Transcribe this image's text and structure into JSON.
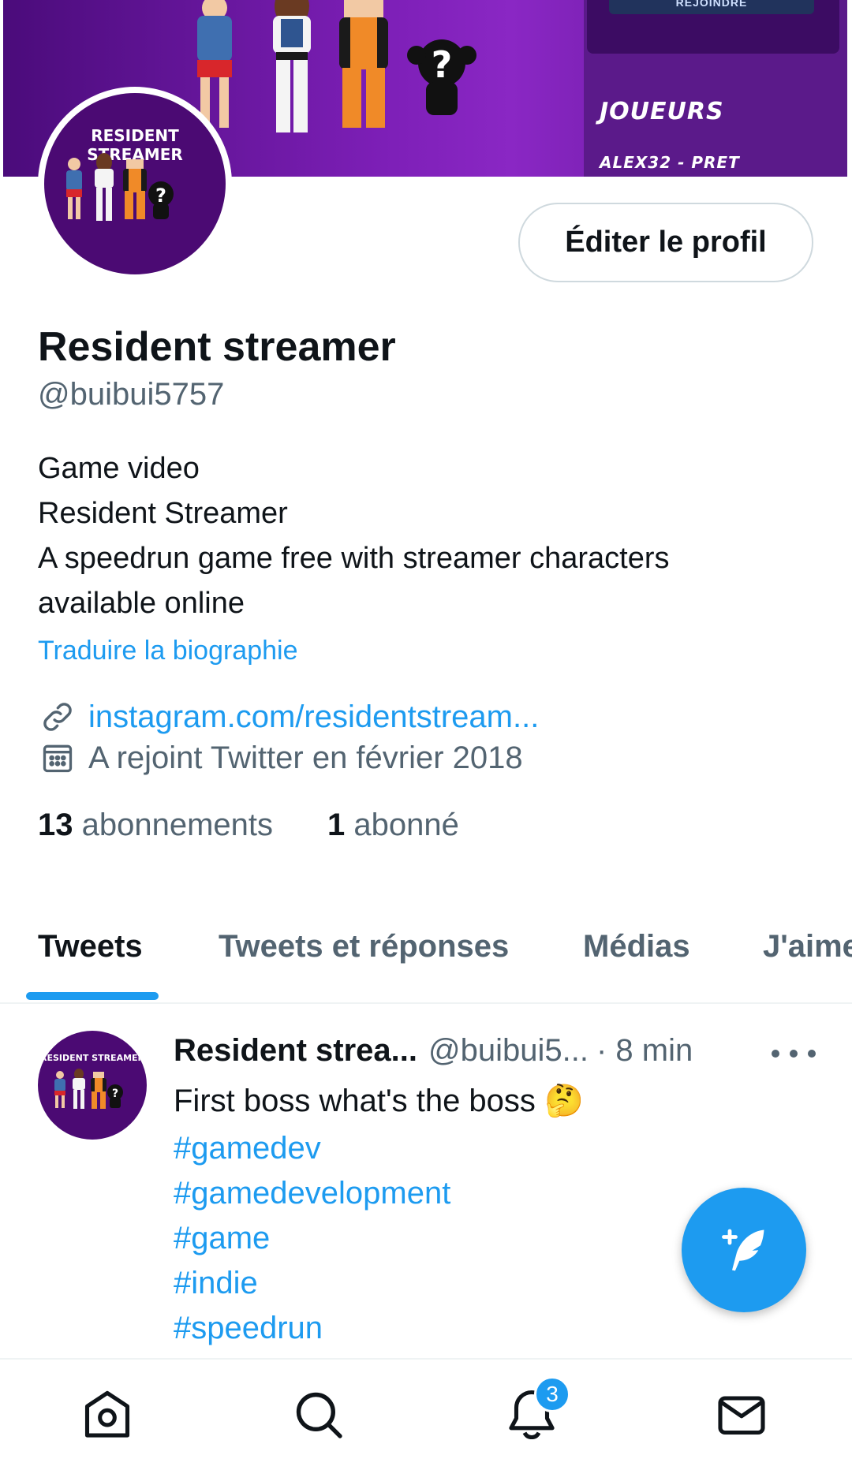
{
  "banner": {
    "panel_button": "REJOINDRE",
    "players_label": "JOUEURS",
    "player_status": "ALEX32 - PRET"
  },
  "profile": {
    "avatar_title": "RESIDENT STREAMER",
    "edit_button": "Éditer le profil",
    "name": "Resident streamer",
    "handle": "@buibui5757",
    "bio": [
      "Game video",
      "Resident Streamer",
      "A speedrun game free with streamer characters",
      "available online"
    ],
    "translate_link": "Traduire la biographie",
    "website": "instagram.com/residentstream...",
    "joined": "A rejoint Twitter en février 2018",
    "following_count": "13",
    "following_label": "abonnements",
    "followers_count": "1",
    "followers_label": "abonné"
  },
  "tabs": [
    "Tweets",
    "Tweets et réponses",
    "Médias",
    "J'aime"
  ],
  "tweet": {
    "name": "Resident strea...",
    "handle": "@buibui5...",
    "time": "· 8 min",
    "text": "First boss what's the boss",
    "emoji": "🤔",
    "hashtags": [
      "#gamedev",
      "#gamedevelopment",
      "#game",
      "#indie",
      "#speedrun"
    ]
  },
  "nav": {
    "icons": [
      "home-icon",
      "search-icon",
      "notifications-icon",
      "messages-icon"
    ],
    "notification_badge": "3"
  },
  "colors": {
    "accent": "#1d9bf0",
    "text": "#0f1419",
    "secondary": "#536471",
    "banner": "#7d1fb7"
  }
}
